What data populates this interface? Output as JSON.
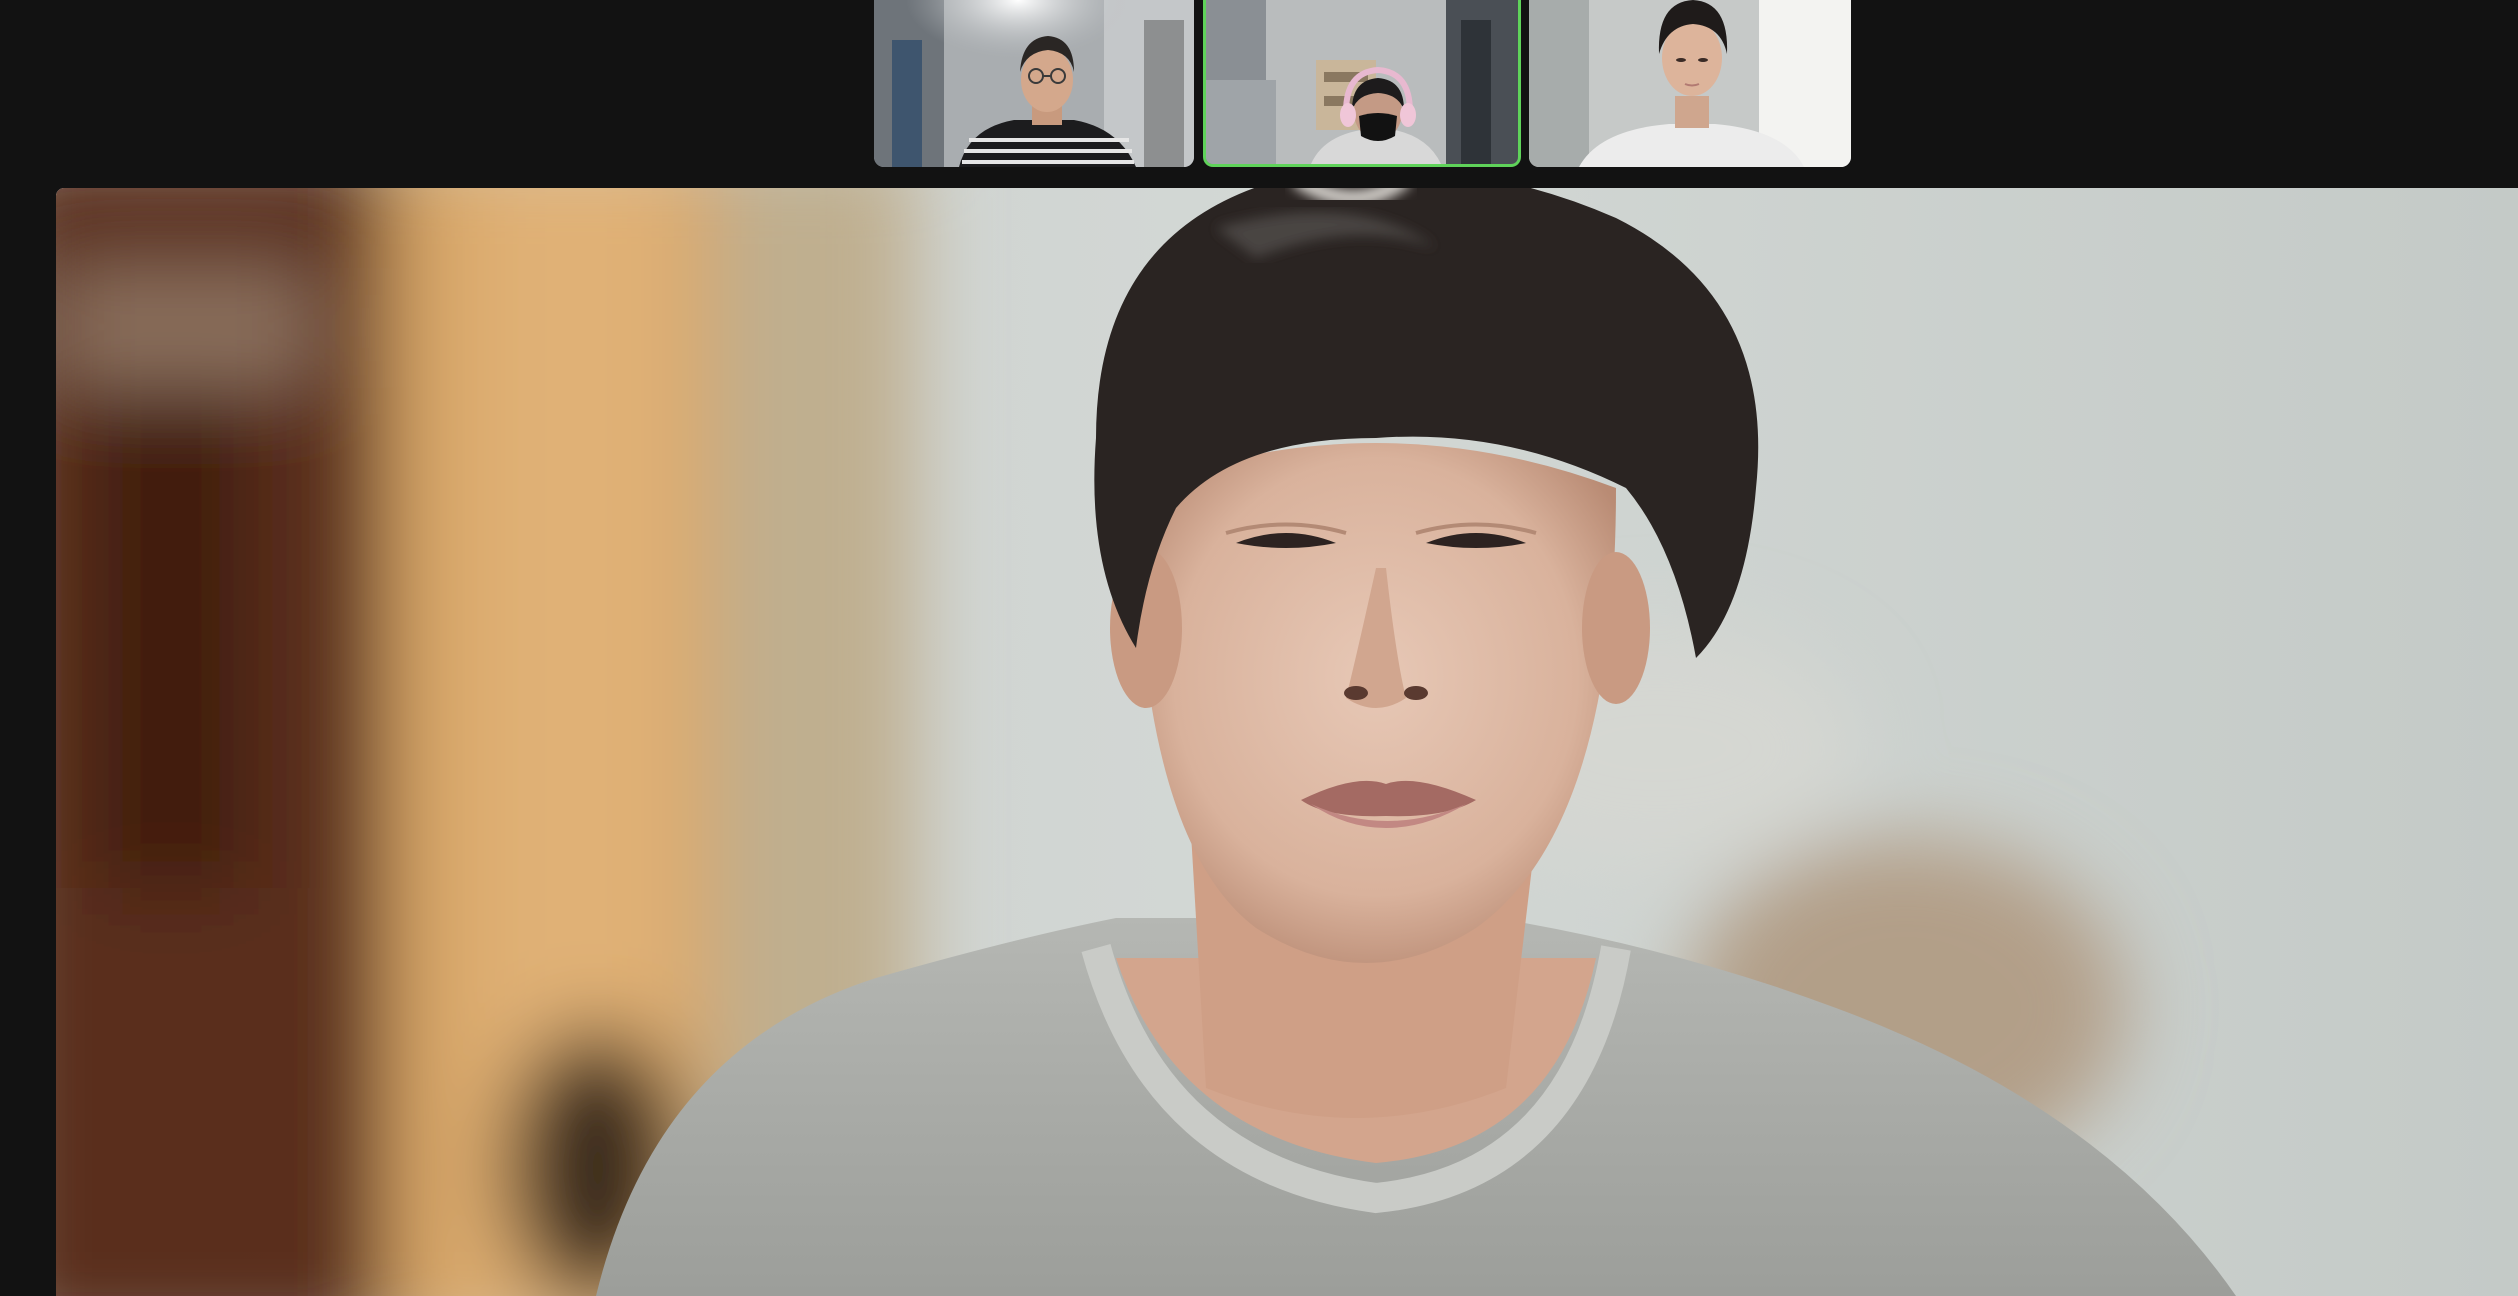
{
  "meeting": {
    "layout": "speaker-view",
    "active_speaker_highlight_color": "#5fd35a",
    "background_color": "#121212"
  },
  "participants": [
    {
      "position": 1,
      "video": "on",
      "is_active_speaker": false,
      "icon": "person-video-icon"
    },
    {
      "position": 2,
      "video": "on",
      "is_active_speaker": true,
      "icon": "person-video-icon"
    },
    {
      "position": 3,
      "video": "on",
      "is_active_speaker": false,
      "icon": "person-video-icon"
    }
  ],
  "main_view": {
    "video": "on",
    "icon": "person-video-icon"
  }
}
